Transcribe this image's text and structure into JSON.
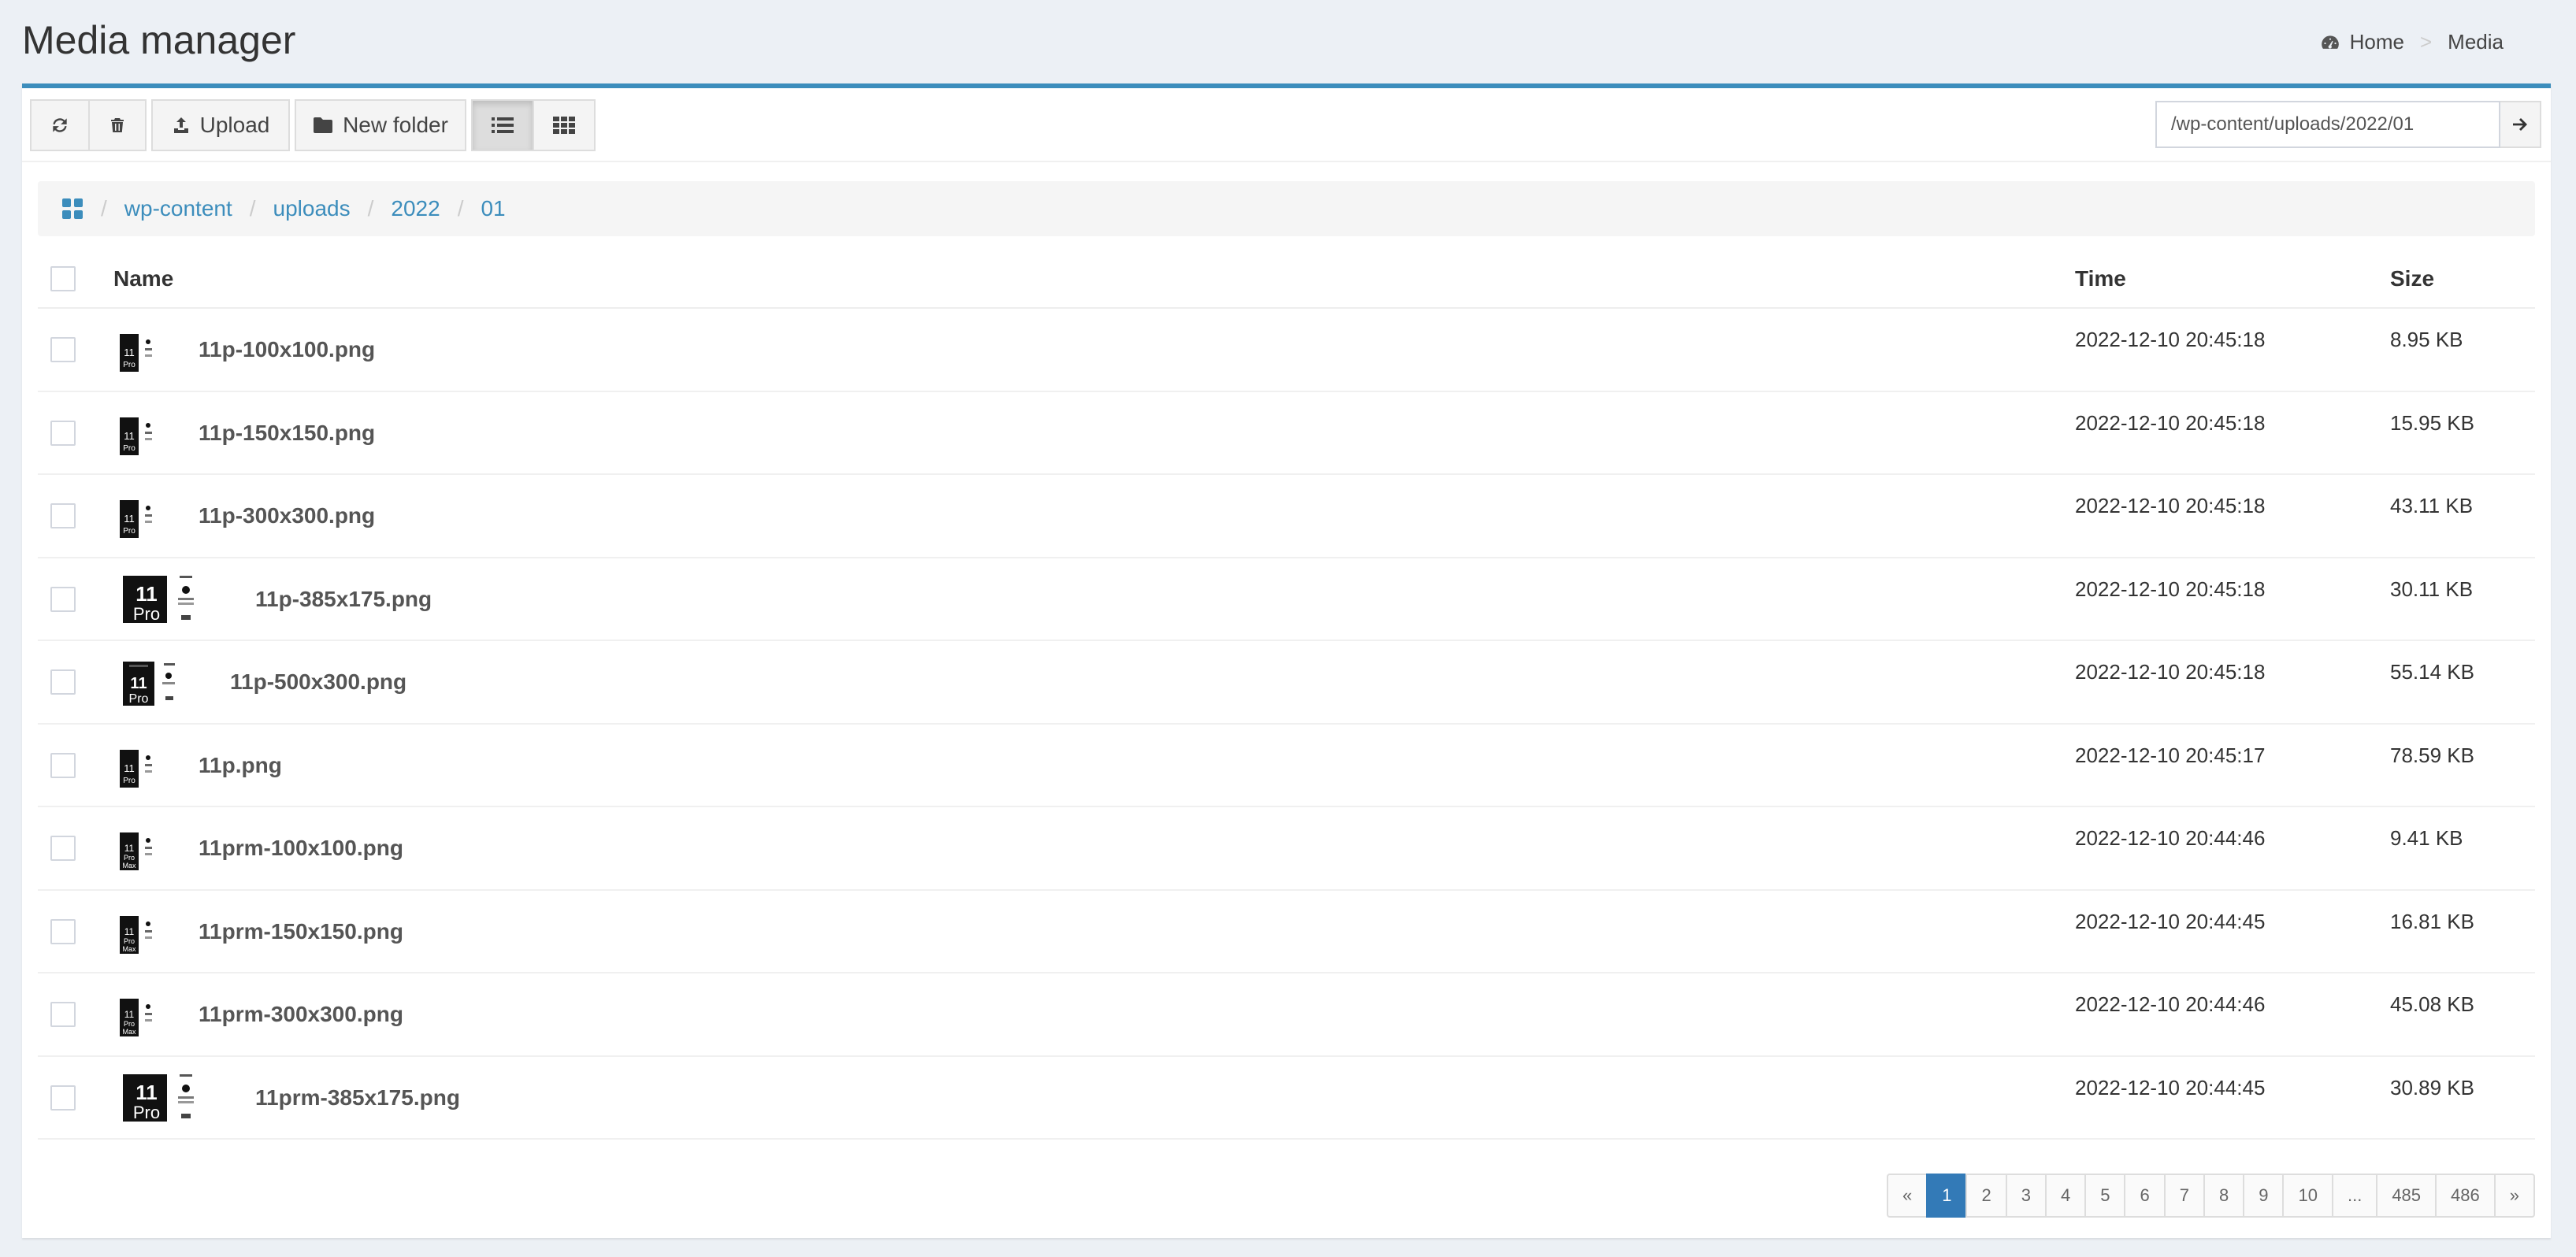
{
  "header": {
    "title": "Media manager",
    "breadcrumb": {
      "home_label": "Home",
      "current_label": "Media"
    }
  },
  "toolbar": {
    "upload_label": "Upload",
    "new_folder_label": "New folder",
    "path_value": "/wp-content/uploads/2022/01"
  },
  "breadcrumb": {
    "segments": [
      "wp-content",
      "uploads",
      "2022",
      "01"
    ]
  },
  "table": {
    "columns": {
      "name": "Name",
      "time": "Time",
      "size": "Size"
    },
    "rows": [
      {
        "name": "11p-100x100.png",
        "time": "2022-12-10 20:45:18",
        "size": "8.95 KB"
      },
      {
        "name": "11p-150x150.png",
        "time": "2022-12-10 20:45:18",
        "size": "15.95 KB"
      },
      {
        "name": "11p-300x300.png",
        "time": "2022-12-10 20:45:18",
        "size": "43.11 KB"
      },
      {
        "name": "11p-385x175.png",
        "time": "2022-12-10 20:45:18",
        "size": "30.11 KB"
      },
      {
        "name": "11p-500x300.png",
        "time": "2022-12-10 20:45:18",
        "size": "55.14 KB"
      },
      {
        "name": "11p.png",
        "time": "2022-12-10 20:45:17",
        "size": "78.59 KB"
      },
      {
        "name": "11prm-100x100.png",
        "time": "2022-12-10 20:44:46",
        "size": "9.41 KB"
      },
      {
        "name": "11prm-150x150.png",
        "time": "2022-12-10 20:44:45",
        "size": "16.81 KB"
      },
      {
        "name": "11prm-300x300.png",
        "time": "2022-12-10 20:44:46",
        "size": "45.08 KB"
      },
      {
        "name": "11prm-385x175.png",
        "time": "2022-12-10 20:44:45",
        "size": "30.89 KB"
      }
    ]
  },
  "pagination": {
    "prev": "«",
    "pages": [
      "1",
      "2",
      "3",
      "4",
      "5",
      "6",
      "7",
      "8",
      "9",
      "10",
      "...",
      "485",
      "486"
    ],
    "next": "»",
    "current": "1"
  },
  "colors": {
    "accent": "#3c8dbc",
    "active_page": "#337ab7",
    "background": "#ecf0f5"
  }
}
